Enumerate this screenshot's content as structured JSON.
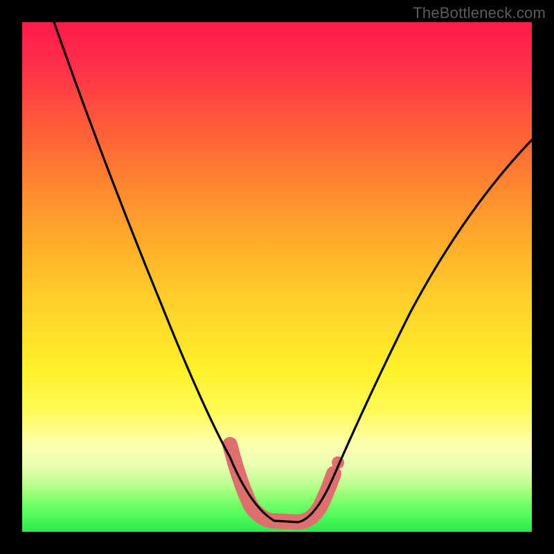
{
  "watermark": "TheBottleneck.com",
  "chart_data": {
    "type": "line",
    "title": "",
    "xlabel": "",
    "ylabel": "",
    "xlim": [
      0,
      100
    ],
    "ylim": [
      0,
      100
    ],
    "series": [
      {
        "name": "bottleneck-curve",
        "x": [
          6,
          10,
          15,
          20,
          25,
          30,
          35,
          40,
          43,
          46,
          50,
          54,
          58,
          62,
          66,
          70,
          75,
          80,
          85,
          90,
          95,
          100
        ],
        "values": [
          100,
          92,
          82,
          71,
          60,
          49,
          38,
          25,
          14,
          5,
          2,
          2,
          3,
          8,
          17,
          27,
          37,
          47,
          56,
          63,
          70,
          76
        ]
      }
    ],
    "annotations": [
      {
        "name": "optimal-range-marker",
        "type": "mask-segment",
        "x_start": 40,
        "x_end": 60,
        "color": "#e27070"
      }
    ],
    "background_gradient": [
      {
        "stop": 0.0,
        "color": "#ff1a4a"
      },
      {
        "stop": 0.5,
        "color": "#ffd22a"
      },
      {
        "stop": 0.8,
        "color": "#fcff70"
      },
      {
        "stop": 1.0,
        "color": "#2ee84e"
      }
    ]
  }
}
